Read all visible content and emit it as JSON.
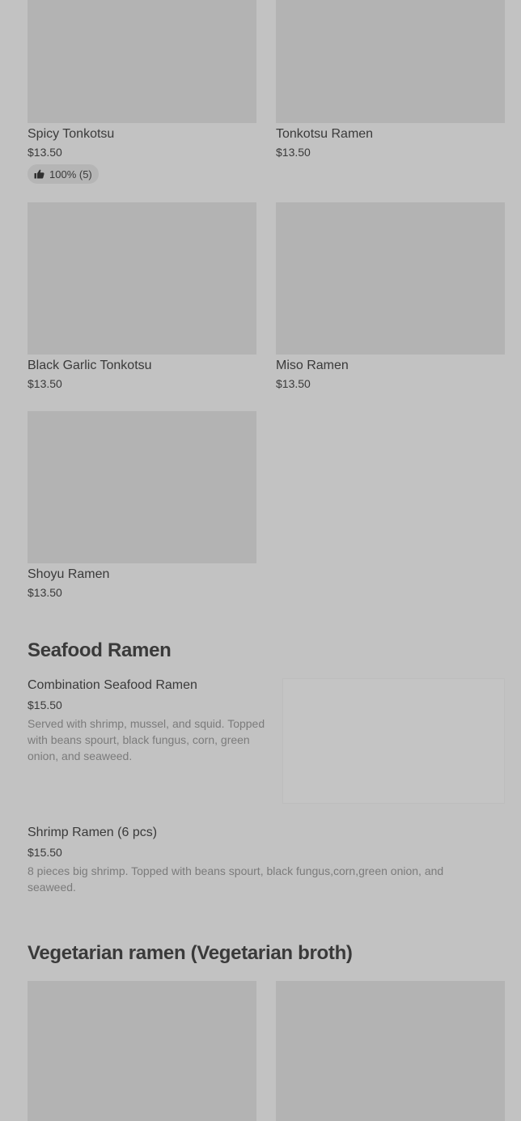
{
  "grid_items": [
    {
      "name": "Spicy Tonkotsu",
      "price": "$13.50",
      "rating": "100% (5)"
    },
    {
      "name": "Tonkotsu Ramen",
      "price": "$13.50"
    },
    {
      "name": "Black Garlic Tonkotsu",
      "price": "$13.50"
    },
    {
      "name": "Miso Ramen",
      "price": "$13.50"
    },
    {
      "name": "Shoyu Ramen",
      "price": "$13.50"
    }
  ],
  "sections": {
    "seafood": {
      "title": "Seafood Ramen",
      "items": [
        {
          "name": "Combination Seafood Ramen",
          "price": "$15.50",
          "description": "Served with shrimp, mussel, and squid. Topped with beans spourt, black fungus, corn, green onion, and seaweed."
        },
        {
          "name": "Shrimp Ramen (6 pcs)",
          "price": "$15.50",
          "description": "8 pieces big shrimp. Topped with beans spourt, black fungus,corn,green onion, and seaweed."
        }
      ]
    },
    "vegetarian": {
      "title": "Vegetarian ramen (Vegetarian broth)"
    }
  },
  "icons": {
    "rating": "thumbs-up-icon"
  },
  "colors": {
    "overlay_background": "#c2c2c2",
    "image_placeholder": "#b3b3b3",
    "text": "#3a3a3a",
    "muted_text": "#7b7b7b"
  }
}
